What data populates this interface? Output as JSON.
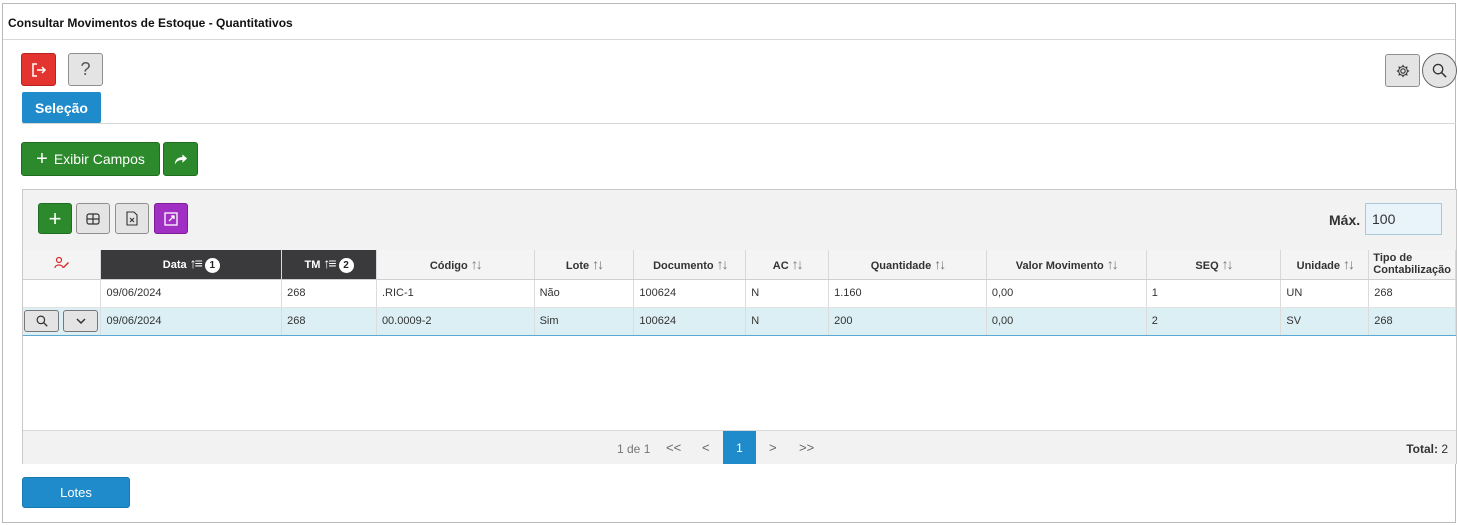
{
  "window": {
    "title": "Consultar Movimentos de Estoque - Quantitativos"
  },
  "toolbar": {
    "help_label": "?"
  },
  "tabs": [
    {
      "label": "Seleção"
    }
  ],
  "actions": {
    "exibir_campos_label": "Exibir Campos"
  },
  "grid": {
    "max_label": "Máx.",
    "max_value": "100",
    "columns": [
      {
        "label": ""
      },
      {
        "label": "Data",
        "sort_order": "1"
      },
      {
        "label": "TM",
        "sort_order": "2"
      },
      {
        "label": "Código"
      },
      {
        "label": "Lote"
      },
      {
        "label": "Documento"
      },
      {
        "label": "AC"
      },
      {
        "label": "Quantidade"
      },
      {
        "label": "Valor Movimento"
      },
      {
        "label": "SEQ"
      },
      {
        "label": "Unidade"
      },
      {
        "label": "Tipo de Contabilização"
      }
    ],
    "rows": [
      {
        "data": "09/06/2024",
        "tm": "268",
        "codigo": ".RIC-1",
        "lote": "Não",
        "documento": "100624",
        "ac": "N",
        "quantidade": "1.160",
        "valor": "0,00",
        "seq": "1",
        "unidade": "UN",
        "tipo": "268"
      },
      {
        "data": "09/06/2024",
        "tm": "268",
        "codigo": "00.0009-2",
        "lote": "Sim",
        "documento": "100624",
        "ac": "N",
        "quantidade": "200",
        "valor": "0,00",
        "seq": "2",
        "unidade": "SV",
        "tipo": "268"
      }
    ]
  },
  "pagination": {
    "info": "1 de 1",
    "first": "<<",
    "prev": "<",
    "current": "1",
    "next": ">",
    "last": ">>",
    "total_label": "Total:",
    "total_value": "2"
  },
  "footer": {
    "lotes_label": "Lotes"
  },
  "colors": {
    "accent_blue": "#1f8bcb",
    "green": "#2c8a2c",
    "red": "#e3342f",
    "purple": "#a12fc4",
    "header_dark": "#3a3a3c"
  }
}
